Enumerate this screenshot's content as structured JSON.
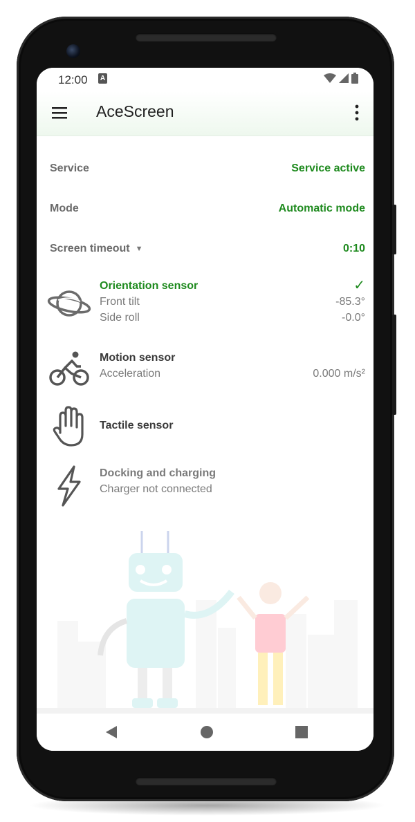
{
  "status_bar": {
    "time": "12:00",
    "notification_icon": "A"
  },
  "app_bar": {
    "title": "AceScreen",
    "menu_icon": "hamburger-menu-icon",
    "overflow_icon": "more-vert-icon"
  },
  "settings": [
    {
      "label": "Service",
      "value": "Service active"
    },
    {
      "label": "Mode",
      "value": "Automatic mode"
    },
    {
      "label": "Screen timeout",
      "value": "0:10",
      "dropdown": true
    }
  ],
  "sensors": {
    "orientation": {
      "icon": "planet-icon",
      "title": "Orientation sensor",
      "status_mark": "✓",
      "rows": [
        {
          "label": "Front tilt",
          "value": "-85.3°"
        },
        {
          "label": "Side roll",
          "value": "-0.0°"
        }
      ]
    },
    "motion": {
      "icon": "bicycle-icon",
      "title": "Motion sensor",
      "rows": [
        {
          "label": "Acceleration",
          "value": "0.000 m/s²"
        }
      ]
    },
    "tactile": {
      "icon": "hand-icon",
      "title": "Tactile sensor"
    },
    "docking": {
      "icon": "lightning-bolt-icon",
      "title": "Docking and charging",
      "subtitle": "Charger not connected"
    }
  },
  "colors": {
    "accent_green": "#1e8a1e",
    "label_grey": "#6b6b6b",
    "appbar_tint": "#eef8ee"
  },
  "nav_bar": {
    "back_icon": "back-triangle-icon",
    "home_icon": "home-circle-icon",
    "recents_icon": "recents-square-icon"
  }
}
